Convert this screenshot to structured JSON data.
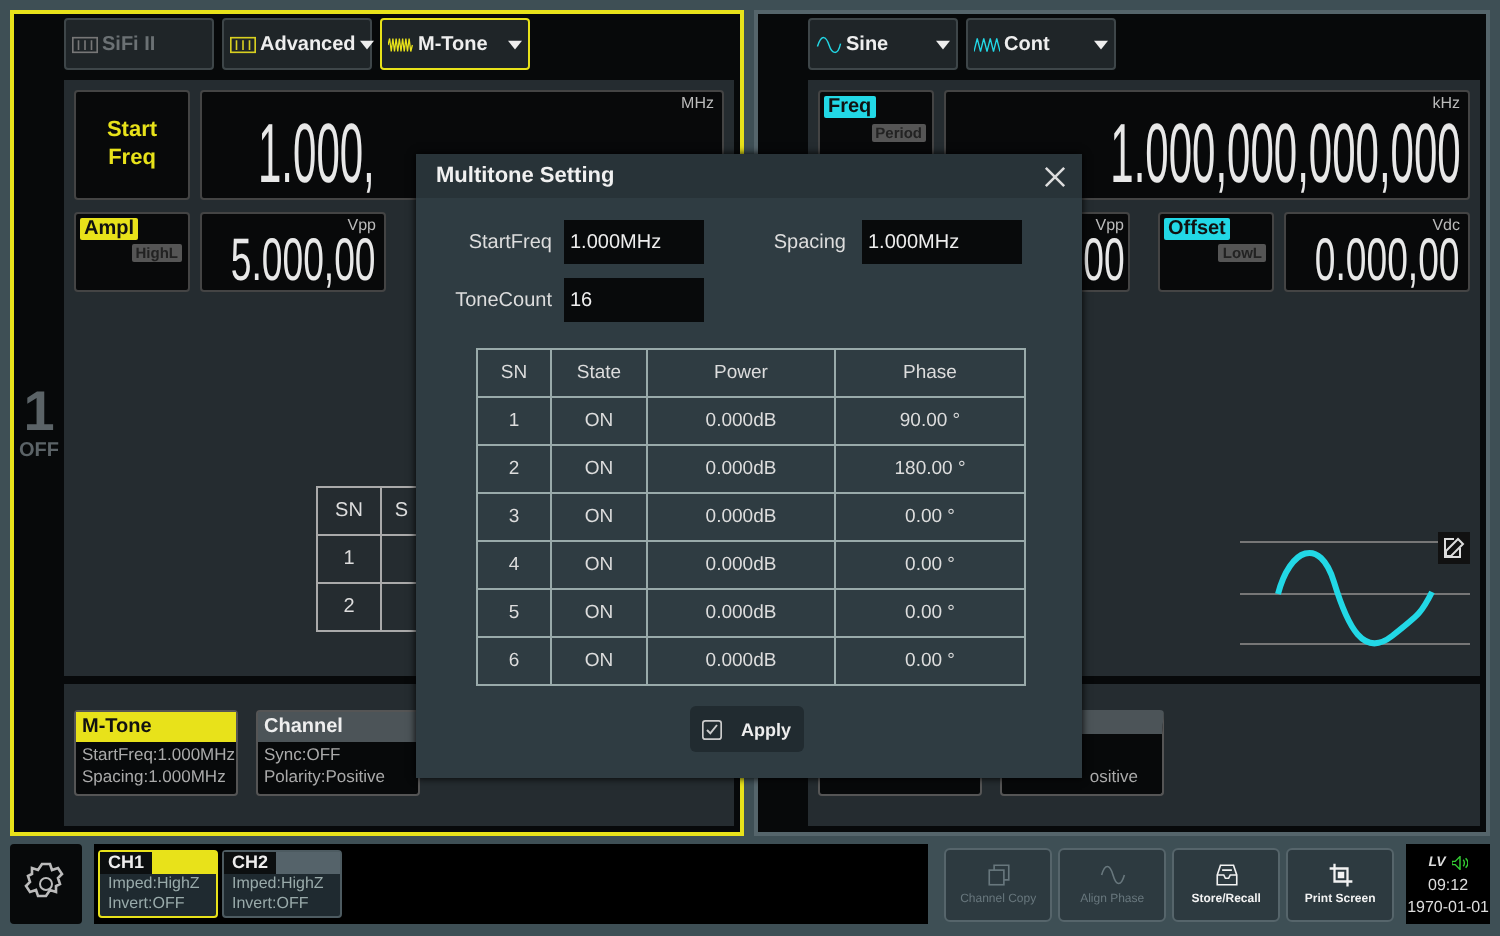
{
  "channels": [
    {
      "number": "1",
      "output": "OFF",
      "active": true,
      "color": "#e8e21a",
      "tabs": [
        {
          "label": "SiFi II",
          "kind": "sliders",
          "selected": false,
          "disabled": true,
          "dropdown": false
        },
        {
          "label": "Advanced",
          "kind": "sliders",
          "selected": false,
          "disabled": false,
          "dropdown": true
        },
        {
          "label": "M-Tone",
          "kind": "multitone",
          "selected": true,
          "disabled": false,
          "dropdown": true
        }
      ],
      "frequency": {
        "label": "Start Freq",
        "unit": "MHz",
        "value": "1.000,"
      },
      "amplitude": {
        "label": "Ampl",
        "alt_label": "HighL",
        "unit": "Vpp",
        "value": "5.000,00"
      },
      "tone_table": {
        "columns": [
          "SN",
          "S"
        ],
        "rows": [
          "1",
          "2"
        ]
      },
      "summary_cards": [
        {
          "title": "M-Tone",
          "selected": true,
          "lines": [
            "StartFreq:1.000MHz",
            "Spacing:1.000MHz"
          ]
        },
        {
          "title": "Channel",
          "selected": false,
          "lines": [
            "Sync:OFF",
            "Polarity:Positive"
          ]
        }
      ]
    },
    {
      "active": false,
      "color": "#22d8e6",
      "tabs": [
        {
          "label": "Sine",
          "kind": "sine",
          "selected": false,
          "disabled": false,
          "dropdown": true
        },
        {
          "label": "Cont",
          "kind": "burst",
          "selected": false,
          "disabled": false,
          "dropdown": true
        }
      ],
      "frequency": {
        "label": "Freq",
        "alt_label": "Period",
        "unit": "kHz",
        "value": "1.000,000,000,000"
      },
      "amplitude": {
        "unit": "Vpp",
        "value": "00"
      },
      "offset": {
        "label": "Offset",
        "alt_label": "LowL",
        "unit": "Vdc",
        "value": "0.000,00"
      },
      "summary_fragment": "ositive"
    }
  ],
  "dialog": {
    "title": "Multitone Setting",
    "fields": [
      {
        "label": "StartFreq",
        "value": "1.000MHz"
      },
      {
        "label": "Spacing",
        "value": "1.000MHz"
      },
      {
        "label": "ToneCount",
        "value": "16"
      }
    ],
    "table": {
      "columns": [
        "SN",
        "State",
        "Power",
        "Phase"
      ],
      "rows": [
        [
          "1",
          "ON",
          "0.000dB",
          "90.00 °"
        ],
        [
          "2",
          "ON",
          "0.000dB",
          "180.00 °"
        ],
        [
          "3",
          "ON",
          "0.000dB",
          "0.00 °"
        ],
        [
          "4",
          "ON",
          "0.000dB",
          "0.00 °"
        ],
        [
          "5",
          "ON",
          "0.000dB",
          "0.00 °"
        ],
        [
          "6",
          "ON",
          "0.000dB",
          "0.00 °"
        ]
      ]
    },
    "apply": {
      "label": "Apply",
      "checked": true
    }
  },
  "bottom_bar": {
    "channel_tabs": [
      {
        "label": "CH1",
        "selected": true,
        "lines": [
          "Imped:HighZ",
          "Invert:OFF"
        ]
      },
      {
        "label": "CH2",
        "selected": false,
        "lines": [
          "Imped:HighZ",
          "Invert:OFF"
        ]
      }
    ],
    "buttons": [
      {
        "label": "Channel Copy",
        "kind": "copy",
        "disabled": true
      },
      {
        "label": "Align Phase",
        "kind": "wave",
        "disabled": true
      },
      {
        "label": "Store/Recall",
        "kind": "tray",
        "disabled": false
      },
      {
        "label": "Print Screen",
        "kind": "crop",
        "disabled": false
      }
    ],
    "status": {
      "mode": "LV",
      "time": "09:12",
      "date": "1970-01-01"
    }
  }
}
